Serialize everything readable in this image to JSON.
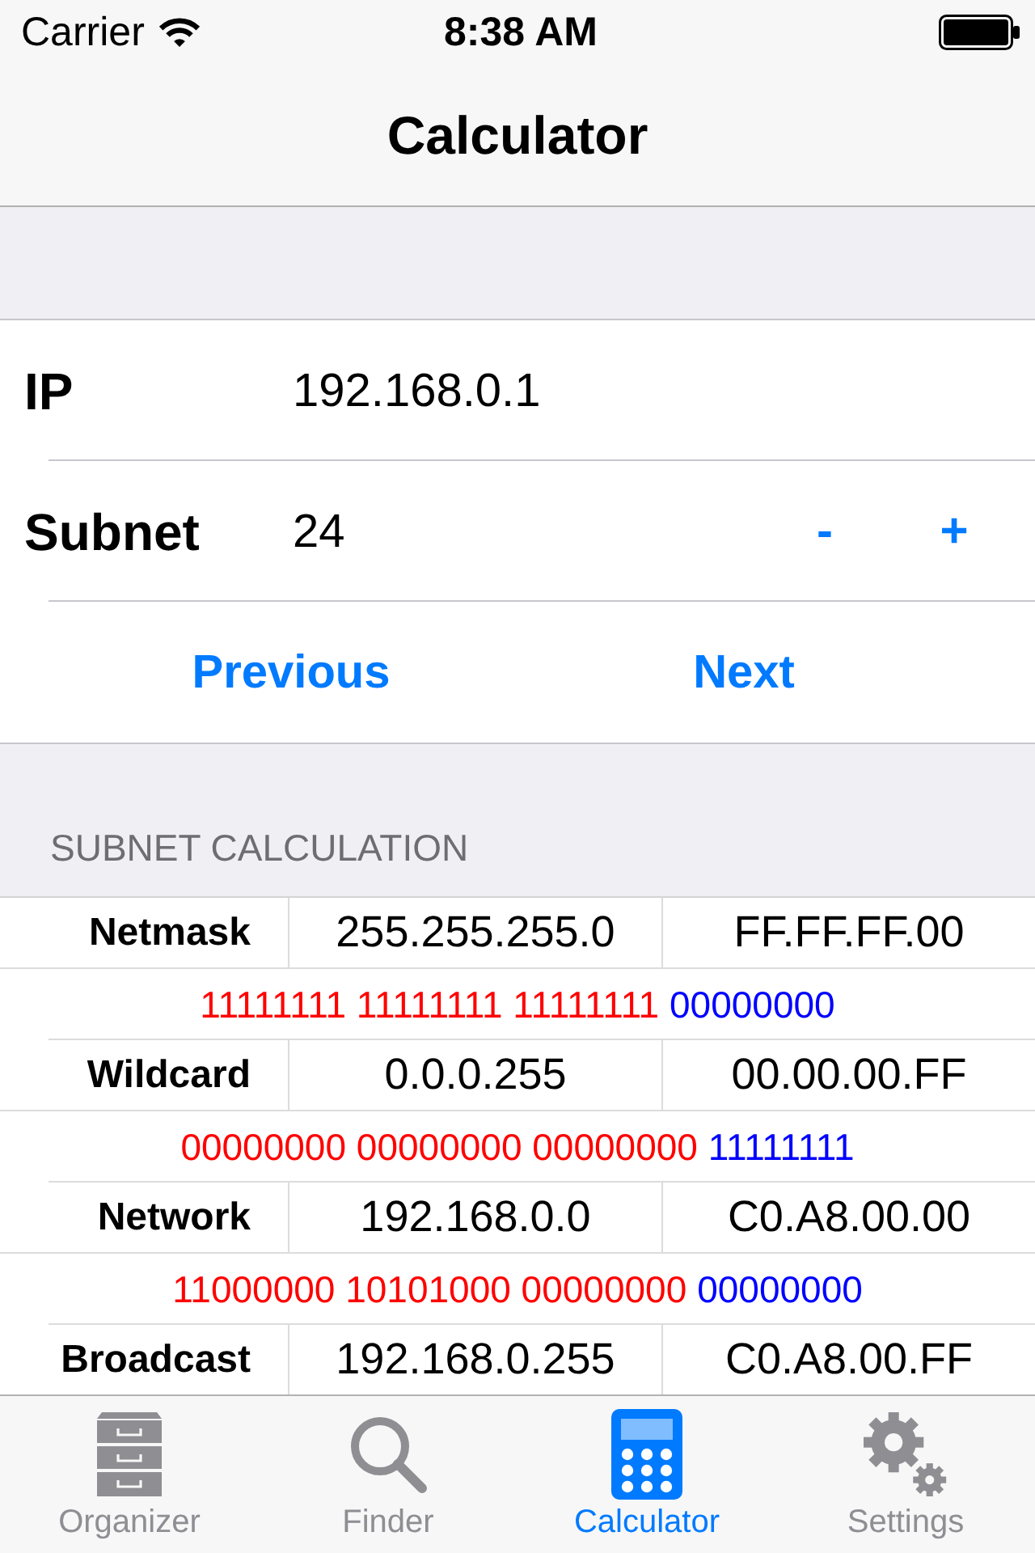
{
  "status_bar": {
    "carrier": "Carrier",
    "time": "8:38 AM"
  },
  "nav_bar": {
    "title": "Calculator"
  },
  "form": {
    "ip": {
      "label": "IP",
      "value": "192.168.0.1"
    },
    "subnet": {
      "label": "Subnet",
      "value": "24",
      "decrement": "-",
      "increment": "+"
    },
    "nav_buttons": [
      {
        "label": "Previous"
      },
      {
        "label": "Next"
      }
    ]
  },
  "results": {
    "header": "SUBNET CALCULATION",
    "rows": [
      {
        "label": "Netmask",
        "decimal": "255.255.255.0",
        "hex": "FF.FF.FF.00",
        "binary": [
          {
            "text": "11111111 11111111 11111111",
            "color": "#ff0000"
          },
          {
            "text": "00000000",
            "color": "#0000ff"
          }
        ]
      },
      {
        "label": "Wildcard",
        "decimal": "0.0.0.255",
        "hex": "00.00.00.FF",
        "binary": [
          {
            "text": "00000000 00000000 00000000",
            "color": "#ff0000"
          },
          {
            "text": "11111111",
            "color": "#0000ff"
          }
        ]
      },
      {
        "label": "Network",
        "decimal": "192.168.0.0",
        "hex": "C0.A8.00.00",
        "binary": [
          {
            "text": "11000000 10101000 00000000",
            "color": "#ff0000"
          },
          {
            "text": "00000000",
            "color": "#0000ff"
          }
        ]
      },
      {
        "label": "Broadcast",
        "decimal": "192.168.0.255",
        "hex": "C0.A8.00.FF"
      }
    ]
  },
  "tab_bar": {
    "tabs": [
      {
        "label": "Organizer",
        "selected": false
      },
      {
        "label": "Finder",
        "selected": false
      },
      {
        "label": "Calculator",
        "selected": true
      },
      {
        "label": "Settings",
        "selected": false
      }
    ]
  }
}
